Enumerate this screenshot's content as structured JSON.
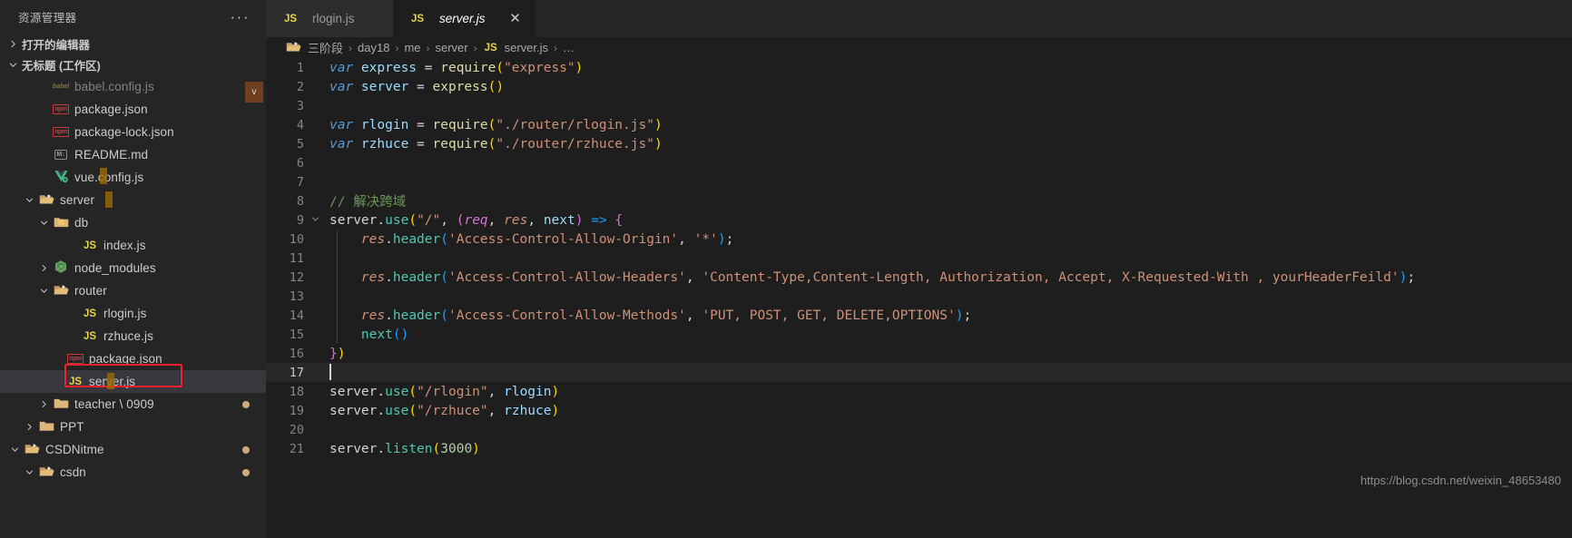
{
  "sidebar": {
    "title": "资源管理器",
    "more_actions": "···",
    "sections": [
      {
        "label": "打开的编辑器",
        "expanded": false
      },
      {
        "label": "无标题 (工作区)",
        "expanded": true
      }
    ],
    "tree": [
      {
        "label": "babel.config.js",
        "icon": "babel-file-icon",
        "depth": 2,
        "type": "file",
        "selected": false,
        "dirty": false,
        "clipped": true
      },
      {
        "label": "package.json",
        "icon": "npm-file-icon",
        "depth": 2,
        "type": "file",
        "selected": false,
        "dirty": false
      },
      {
        "label": "package-lock.json",
        "icon": "npm-file-icon",
        "depth": 2,
        "type": "file",
        "selected": false,
        "dirty": false
      },
      {
        "label": "README.md",
        "icon": "markdown-file-icon",
        "depth": 2,
        "type": "file",
        "selected": false,
        "dirty": false
      },
      {
        "label": "vue.config.js",
        "icon": "vue-file-icon",
        "depth": 2,
        "type": "file",
        "selected": false,
        "dirty": false,
        "mark": true
      },
      {
        "label": "server",
        "icon": "folder-open-icon",
        "depth": 1,
        "type": "folder",
        "expanded": true,
        "selected": false,
        "dirty": false,
        "mark": true
      },
      {
        "label": "db",
        "icon": "folder-db-icon",
        "depth": 2,
        "type": "folder",
        "expanded": true,
        "selected": false,
        "dirty": false
      },
      {
        "label": "index.js",
        "icon": "js-file-icon",
        "depth": 4,
        "type": "file",
        "selected": false,
        "dirty": false
      },
      {
        "label": "node_modules",
        "icon": "folder-node-icon",
        "depth": 2,
        "type": "folder",
        "expanded": false,
        "selected": false,
        "dirty": false
      },
      {
        "label": "router",
        "icon": "folder-open-icon",
        "depth": 2,
        "type": "folder",
        "expanded": true,
        "selected": false,
        "dirty": false
      },
      {
        "label": "rlogin.js",
        "icon": "js-file-icon",
        "depth": 4,
        "type": "file",
        "selected": false,
        "dirty": false
      },
      {
        "label": "rzhuce.js",
        "icon": "js-file-icon",
        "depth": 4,
        "type": "file",
        "selected": false,
        "dirty": false
      },
      {
        "label": "package.json",
        "icon": "npm-file-icon",
        "depth": 3,
        "type": "file",
        "selected": false,
        "dirty": false
      },
      {
        "label": "server.js",
        "icon": "js-file-icon",
        "depth": 3,
        "type": "file",
        "selected": true,
        "dirty": false,
        "highlighted": true,
        "mark": true
      },
      {
        "label": "teacher \\ 0909",
        "icon": "folder-icon",
        "depth": 2,
        "type": "folder",
        "expanded": false,
        "selected": false,
        "dirty": true
      },
      {
        "label": "PPT",
        "icon": "folder-icon",
        "depth": 1,
        "type": "folder",
        "expanded": false,
        "selected": false,
        "dirty": false
      },
      {
        "label": "CSDNitme",
        "icon": "folder-open-icon",
        "depth": 0,
        "type": "folder",
        "expanded": true,
        "selected": false,
        "dirty": true
      },
      {
        "label": "csdn",
        "icon": "folder-open-icon",
        "depth": 1,
        "type": "folder",
        "expanded": true,
        "selected": false,
        "dirty": true
      }
    ]
  },
  "tabs": [
    {
      "label": "rlogin.js",
      "icon": "js-file-icon",
      "active": false,
      "closable": false
    },
    {
      "label": "server.js",
      "icon": "js-file-icon",
      "active": true,
      "closable": true,
      "close_label": "✕"
    }
  ],
  "breadcrumb": {
    "root_icon": "folder-open-icon",
    "items": [
      "三阶段",
      "day18",
      "me",
      "server",
      "server.js",
      "…"
    ],
    "file_icon": "js-file-icon",
    "separator": "›"
  },
  "code": {
    "lines": [
      {
        "n": "1",
        "tokens": [
          {
            "t": "var ",
            "c": "t-kw"
          },
          {
            "t": "express",
            "c": "t-var"
          },
          {
            "t": " ",
            "c": "t-plain"
          },
          {
            "t": "=",
            "c": "t-op"
          },
          {
            "t": " ",
            "c": "t-plain"
          },
          {
            "t": "require",
            "c": "t-fn"
          },
          {
            "t": "(",
            "c": "t-par1"
          },
          {
            "t": "\"express\"",
            "c": "t-str"
          },
          {
            "t": ")",
            "c": "t-par1"
          }
        ]
      },
      {
        "n": "2",
        "tokens": [
          {
            "t": "var ",
            "c": "t-kw"
          },
          {
            "t": "server",
            "c": "t-var"
          },
          {
            "t": " ",
            "c": "t-plain"
          },
          {
            "t": "=",
            "c": "t-op"
          },
          {
            "t": " ",
            "c": "t-plain"
          },
          {
            "t": "express",
            "c": "t-fn"
          },
          {
            "t": "(",
            "c": "t-par1"
          },
          {
            "t": ")",
            "c": "t-par1"
          }
        ]
      },
      {
        "n": "3",
        "tokens": []
      },
      {
        "n": "4",
        "tokens": [
          {
            "t": "var ",
            "c": "t-kw"
          },
          {
            "t": "rlogin",
            "c": "t-var"
          },
          {
            "t": " ",
            "c": "t-plain"
          },
          {
            "t": "=",
            "c": "t-op"
          },
          {
            "t": " ",
            "c": "t-plain"
          },
          {
            "t": "require",
            "c": "t-fn"
          },
          {
            "t": "(",
            "c": "t-par1"
          },
          {
            "t": "\"./router/rlogin.js\"",
            "c": "t-str"
          },
          {
            "t": ")",
            "c": "t-par1"
          }
        ]
      },
      {
        "n": "5",
        "tokens": [
          {
            "t": "var ",
            "c": "t-kw"
          },
          {
            "t": "rzhuce",
            "c": "t-var"
          },
          {
            "t": " ",
            "c": "t-plain"
          },
          {
            "t": "=",
            "c": "t-op"
          },
          {
            "t": " ",
            "c": "t-plain"
          },
          {
            "t": "require",
            "c": "t-fn"
          },
          {
            "t": "(",
            "c": "t-par1"
          },
          {
            "t": "\"./router/rzhuce.js\"",
            "c": "t-str"
          },
          {
            "t": ")",
            "c": "t-par1"
          }
        ]
      },
      {
        "n": "6",
        "tokens": []
      },
      {
        "n": "7",
        "tokens": []
      },
      {
        "n": "8",
        "tokens": [
          {
            "t": "// 解决跨域",
            "c": "t-com"
          }
        ]
      },
      {
        "n": "9",
        "fold": "v",
        "tokens": [
          {
            "t": "server",
            "c": "t-plain"
          },
          {
            "t": ".",
            "c": "t-punc"
          },
          {
            "t": "use",
            "c": "t-meth"
          },
          {
            "t": "(",
            "c": "t-par1"
          },
          {
            "t": "\"/\"",
            "c": "t-str"
          },
          {
            "t": ", ",
            "c": "t-punc"
          },
          {
            "t": "(",
            "c": "t-par2"
          },
          {
            "t": "req",
            "c": "t-param-req"
          },
          {
            "t": ", ",
            "c": "t-punc"
          },
          {
            "t": "res",
            "c": "t-param-res"
          },
          {
            "t": ", ",
            "c": "t-punc"
          },
          {
            "t": "next",
            "c": "t-param-next"
          },
          {
            "t": ")",
            "c": "t-par2"
          },
          {
            "t": " ",
            "c": "t-plain"
          },
          {
            "t": "=>",
            "c": "t-par3"
          },
          {
            "t": " ",
            "c": "t-plain"
          },
          {
            "t": "{",
            "c": "t-par2"
          }
        ]
      },
      {
        "n": "10",
        "indent": true,
        "tokens": [
          {
            "t": "    ",
            "c": "t-plain"
          },
          {
            "t": "res",
            "c": "t-param-res"
          },
          {
            "t": ".",
            "c": "t-punc"
          },
          {
            "t": "header",
            "c": "t-meth"
          },
          {
            "t": "(",
            "c": "t-par3"
          },
          {
            "t": "'Access-Control-Allow-Origin'",
            "c": "t-str"
          },
          {
            "t": ", ",
            "c": "t-punc"
          },
          {
            "t": "'*'",
            "c": "t-str"
          },
          {
            "t": ")",
            "c": "t-par3"
          },
          {
            "t": ";",
            "c": "t-punc"
          }
        ]
      },
      {
        "n": "11",
        "indent": true,
        "tokens": []
      },
      {
        "n": "12",
        "indent": true,
        "tokens": [
          {
            "t": "    ",
            "c": "t-plain"
          },
          {
            "t": "res",
            "c": "t-param-res"
          },
          {
            "t": ".",
            "c": "t-punc"
          },
          {
            "t": "header",
            "c": "t-meth"
          },
          {
            "t": "(",
            "c": "t-par3"
          },
          {
            "t": "'Access-Control-Allow-Headers'",
            "c": "t-str"
          },
          {
            "t": ", ",
            "c": "t-punc"
          },
          {
            "t": "'Content-Type,Content-Length, Authorization, Accept, X-Requested-With , yourHeaderFeild'",
            "c": "t-str"
          },
          {
            "t": ")",
            "c": "t-par3"
          },
          {
            "t": ";",
            "c": "t-punc"
          }
        ]
      },
      {
        "n": "13",
        "indent": true,
        "tokens": []
      },
      {
        "n": "14",
        "indent": true,
        "tokens": [
          {
            "t": "    ",
            "c": "t-plain"
          },
          {
            "t": "res",
            "c": "t-param-res"
          },
          {
            "t": ".",
            "c": "t-punc"
          },
          {
            "t": "header",
            "c": "t-meth"
          },
          {
            "t": "(",
            "c": "t-par3"
          },
          {
            "t": "'Access-Control-Allow-Methods'",
            "c": "t-str"
          },
          {
            "t": ", ",
            "c": "t-punc"
          },
          {
            "t": "'PUT, POST, GET, DELETE,OPTIONS'",
            "c": "t-str"
          },
          {
            "t": ")",
            "c": "t-par3"
          },
          {
            "t": ";",
            "c": "t-punc"
          }
        ]
      },
      {
        "n": "15",
        "indent": true,
        "tokens": [
          {
            "t": "    ",
            "c": "t-plain"
          },
          {
            "t": "next",
            "c": "t-meth"
          },
          {
            "t": "(",
            "c": "t-par3"
          },
          {
            "t": ")",
            "c": "t-par3"
          }
        ]
      },
      {
        "n": "16",
        "tokens": [
          {
            "t": "}",
            "c": "t-par2"
          },
          {
            "t": ")",
            "c": "t-par1"
          }
        ]
      },
      {
        "n": "17",
        "active": true,
        "cursor": true,
        "tokens": []
      },
      {
        "n": "18",
        "tokens": [
          {
            "t": "server",
            "c": "t-plain"
          },
          {
            "t": ".",
            "c": "t-punc"
          },
          {
            "t": "use",
            "c": "t-meth"
          },
          {
            "t": "(",
            "c": "t-par1"
          },
          {
            "t": "\"/rlogin\"",
            "c": "t-str"
          },
          {
            "t": ", ",
            "c": "t-punc"
          },
          {
            "t": "rlogin",
            "c": "t-var"
          },
          {
            "t": ")",
            "c": "t-par1"
          }
        ]
      },
      {
        "n": "19",
        "tokens": [
          {
            "t": "server",
            "c": "t-plain"
          },
          {
            "t": ".",
            "c": "t-punc"
          },
          {
            "t": "use",
            "c": "t-meth"
          },
          {
            "t": "(",
            "c": "t-par1"
          },
          {
            "t": "\"/rzhuce\"",
            "c": "t-str"
          },
          {
            "t": ", ",
            "c": "t-punc"
          },
          {
            "t": "rzhuce",
            "c": "t-var"
          },
          {
            "t": ")",
            "c": "t-par1"
          }
        ]
      },
      {
        "n": "20",
        "tokens": []
      },
      {
        "n": "21",
        "tokens": [
          {
            "t": "server",
            "c": "t-plain"
          },
          {
            "t": ".",
            "c": "t-punc"
          },
          {
            "t": "listen",
            "c": "t-meth"
          },
          {
            "t": "(",
            "c": "t-par1"
          },
          {
            "t": "3000",
            "c": "t-num"
          },
          {
            "t": ")",
            "c": "t-par1"
          }
        ]
      }
    ]
  },
  "watermark": "https://blog.csdn.net/weixin_48653480",
  "colors": {
    "sidebar_bg": "#252526",
    "editor_bg": "#1e1e1e",
    "tab_inactive_bg": "#2d2d2d",
    "selection_bg": "#37373d",
    "highlight_border": "#f4212a",
    "dirty_dot": "#cdab78",
    "find_match": "#9e6a03"
  }
}
